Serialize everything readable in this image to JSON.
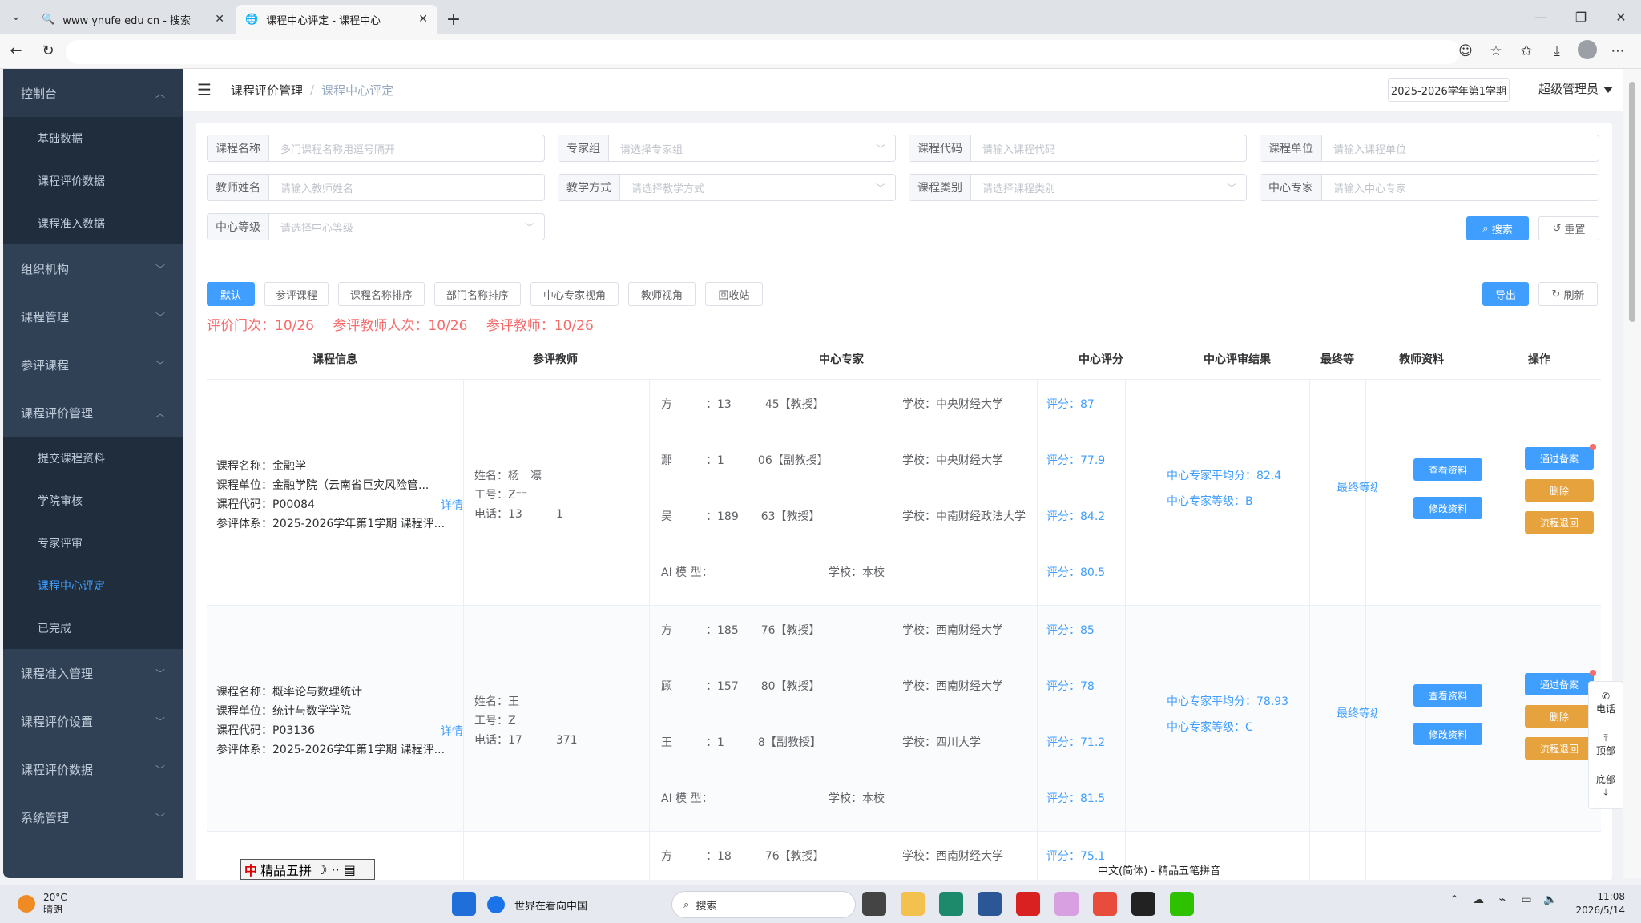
{
  "browser": {
    "tabs": [
      {
        "title": "www ynufe edu cn - 搜索",
        "active": false
      },
      {
        "title": "课程中心评定 - 课程中心",
        "active": true
      }
    ],
    "new_tab": "+"
  },
  "sidebar": {
    "groups": [
      {
        "label": "控制台",
        "expanded": true,
        "children": [
          "基础数据",
          "课程评价数据",
          "课程准入数据"
        ]
      },
      {
        "label": "组织机构",
        "expanded": false
      },
      {
        "label": "课程管理",
        "expanded": false
      },
      {
        "label": "参评课程",
        "expanded": false
      },
      {
        "label": "课程评价管理",
        "expanded": true,
        "children": [
          "提交课程资料",
          "学院审核",
          "专家评审",
          "课程中心评定",
          "已完成"
        ]
      },
      {
        "label": "课程准入管理",
        "expanded": false
      },
      {
        "label": "课程评价设置",
        "expanded": false
      },
      {
        "label": "课程评价数据",
        "expanded": false
      },
      {
        "label": "系统管理",
        "expanded": false
      }
    ],
    "active_item": "课程中心评定"
  },
  "navbar": {
    "breadcrumb": [
      "课程评价管理",
      "课程中心评定"
    ],
    "term": "2025-2026学年第1学期",
    "user": "超级管理员"
  },
  "search": {
    "fields": [
      {
        "label": "课程名称",
        "placeholder": "多门课程名称用逗号隔开",
        "type": "input"
      },
      {
        "label": "专家组",
        "placeholder": "请选择专家组",
        "type": "select"
      },
      {
        "label": "课程代码",
        "placeholder": "请输入课程代码",
        "type": "input"
      },
      {
        "label": "课程单位",
        "placeholder": "请输入课程单位",
        "type": "input"
      },
      {
        "label": "教师姓名",
        "placeholder": "请输入教师姓名",
        "type": "input"
      },
      {
        "label": "教学方式",
        "placeholder": "请选择教学方式",
        "type": "select"
      },
      {
        "label": "课程类别",
        "placeholder": "请选择课程类别",
        "type": "select"
      },
      {
        "label": "中心专家",
        "placeholder": "请输入中心专家",
        "type": "input"
      },
      {
        "label": "中心等级",
        "placeholder": "请选择中心等级",
        "type": "select"
      }
    ],
    "search_label": "搜索",
    "reset_label": "重置"
  },
  "toolbar": {
    "tabs": [
      "默认",
      "参评课程",
      "课程名称排序",
      "部门名称排序",
      "中心专家视角",
      "教师视角",
      "回收站"
    ],
    "export_label": "导出",
    "refresh_label": "刷新"
  },
  "stats": [
    "评价门次：10/26",
    "参评教师人次：10/26",
    "参评教师：10/26"
  ],
  "table": {
    "headers": [
      "课程信息",
      "参评教师",
      "中心专家",
      "中心评分",
      "中心评审结果",
      "最终等",
      "教师资料",
      "操作"
    ],
    "rows": [
      {
        "course": [
          "课程名称：金融学",
          "课程单位：金融学院（云南省巨灾风险管...",
          "课程代码：P00084",
          "参评体系：2025-2026学年第1学期 课程评..."
        ],
        "detail": "详情",
        "teacher": [
          "姓名：杨　凛",
          "工号：Z⁻⁻",
          "电话：13　　　1"
        ],
        "experts": [
          {
            "name": "方　　　：13　　　45【教授】",
            "school": "学校：中央财经大学",
            "score": "评分：87"
          },
          {
            "name": "鄢　　　：1　　　06【副教授】",
            "school": "学校：中央财经大学",
            "score": "评分：77.9"
          },
          {
            "name": "吴　　　：189　　63【教授】",
            "school": "学校：中南财经政法大学",
            "score": "评分：84.2"
          },
          {
            "name": "AI 模 型：",
            "school": "学校：本校",
            "score": "评分：80.5"
          }
        ],
        "result": [
          "中心专家平均分：82.4",
          "中心专家等级：B"
        ],
        "final": "最终等级",
        "teacher_actions": [
          "查看资料",
          "修改资料"
        ],
        "actions": [
          "通过备案",
          "删除",
          "流程退回"
        ]
      },
      {
        "course": [
          "课程名称：概率论与数理统计",
          "课程单位：统计与数学学院",
          "课程代码：P03136",
          "参评体系：2025-2026学年第1学期 课程评..."
        ],
        "detail": "详情",
        "teacher": [
          "姓名：王　",
          "工号：Z　",
          "电话：17　　　371"
        ],
        "experts": [
          {
            "name": "方　　　：185　　76【教授】",
            "school": "学校：西南财经大学",
            "score": "评分：85"
          },
          {
            "name": "顾　　　：157　　80【教授】",
            "school": "学校：西南财经大学",
            "score": "评分：78"
          },
          {
            "name": "王　　　：1　　　8【副教授】",
            "school": "学校：四川大学",
            "score": "评分：71.2"
          },
          {
            "name": "AI 模 型：",
            "school": "学校：本校",
            "score": "评分：81.5"
          }
        ],
        "result": [
          "中心专家平均分：78.93",
          "中心专家等级：C"
        ],
        "final": "最终等级",
        "teacher_actions": [
          "查看资料",
          "修改资料"
        ],
        "actions": [
          "通过备案",
          "删除",
          "流程退回"
        ]
      },
      {
        "experts": [
          {
            "name": "方　　　：18　　　76【教授】",
            "school": "学校：西南财经大学",
            "score": "评分：75.1"
          }
        ]
      }
    ]
  },
  "float_bar": [
    "电话",
    "顶部",
    "底部"
  ],
  "ime": {
    "bar1": "精品五拼",
    "bar2": "中文(简体) - 精品五笔拼音"
  },
  "taskbar": {
    "weather_temp": "20°C",
    "weather_desc": "晴朗",
    "news": "世界在看向中国",
    "search": "搜索",
    "time": "11:08",
    "date": "2026/5/14"
  }
}
